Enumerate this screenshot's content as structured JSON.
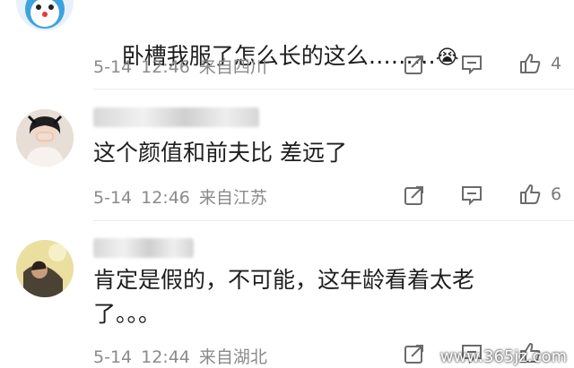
{
  "comments": [
    {
      "text": "卧槽我服了怎么长的这么………",
      "emoji": "😭",
      "date": "5-14",
      "time": "12:46",
      "location": "来自四川",
      "likes": "4"
    },
    {
      "text": "这个颜值和前夫比 差远了",
      "date": "5-14",
      "time": "12:46",
      "location": "来自江苏",
      "likes": "6"
    },
    {
      "text": "肯定是假的，不可能，这年龄看着太老\n了。。。",
      "date": "5-14",
      "time": "12:44",
      "location": "来自湖北",
      "likes": ""
    }
  ],
  "icons": {
    "share": "share-icon",
    "reply": "comment-icon",
    "like": "thumbs-up-icon"
  },
  "watermark": "www.365jz.com"
}
